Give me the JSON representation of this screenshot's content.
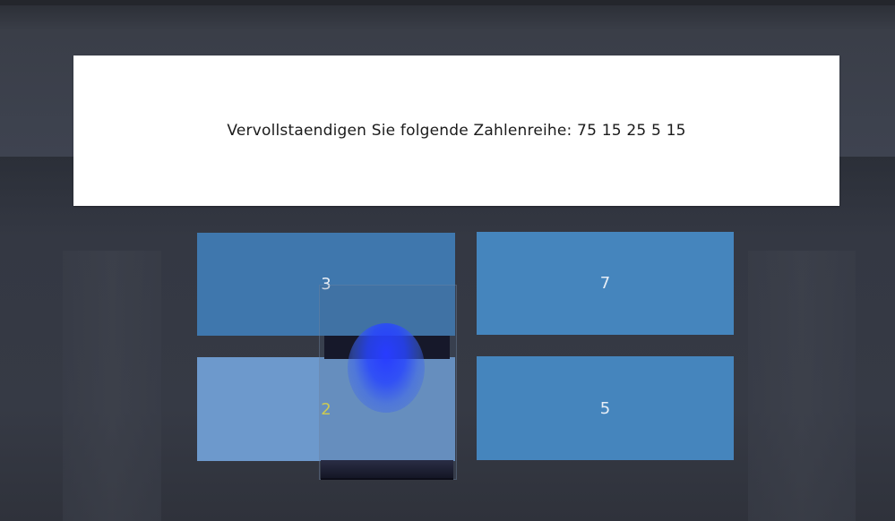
{
  "question": {
    "text": "Vervollstaendigen Sie folgende Zahlenreihe: 75 15 25 5 15"
  },
  "answers": [
    {
      "label": "3",
      "color": "#3f77ad"
    },
    {
      "label": "7",
      "color": "#4585bd"
    },
    {
      "label": "2",
      "color": "#6d99cc",
      "highlighted": true,
      "highlight_text_color": "#e8e14a"
    },
    {
      "label": "5",
      "color": "#4585bd"
    }
  ],
  "controller": {
    "icon": "vr-controller-icon",
    "pointer_color": "#2840ff"
  },
  "colors": {
    "panel_background": "#ffffff",
    "scene_background": "#3e4350"
  }
}
